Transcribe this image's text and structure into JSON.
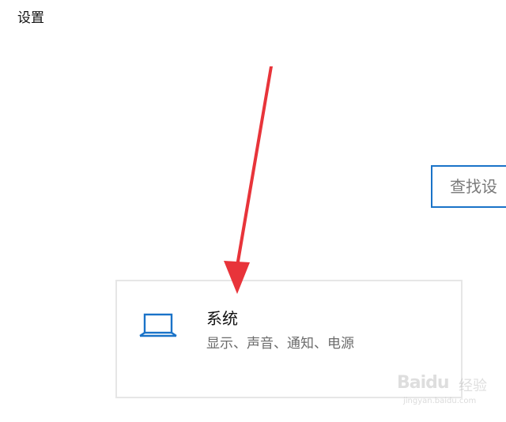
{
  "window": {
    "title": "设置"
  },
  "search": {
    "placeholder": "查找设"
  },
  "tiles": [
    {
      "icon": "laptop-icon",
      "title": "系统",
      "description": "显示、声音、通知、电源"
    }
  ],
  "annotation": {
    "icon": "red-arrow-pointer",
    "color": "#e8343a"
  },
  "watermark": {
    "brand": "Baidu",
    "brand_cn": "经验",
    "url": "jingyan.baidu.com"
  },
  "colors": {
    "accent": "#1a73c8",
    "tile_border": "#e6e6e6"
  }
}
